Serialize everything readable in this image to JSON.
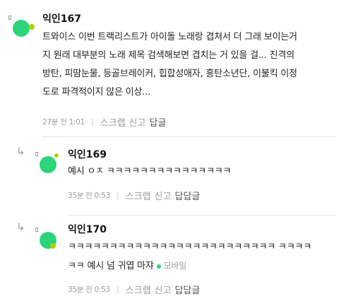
{
  "comments": [
    {
      "author": "익인167",
      "lines": [
        "트와이스 이번 트랙리스트가 아이돌 노래랑 겹쳐서 더 그래 보이는거",
        "지 원래 대부분의 노래 제목 검색해보면 겹치는 거 있을 걸... 진격의",
        "방탄, 피땀눈물, 등골브레이커, 힙합성애자, 흥탄소년단, 이불킥 이정",
        "도로 파격적이지 않은 이상..."
      ],
      "time": "27분 전 1:01",
      "scrap_label": "스크랩",
      "report_label": "신고",
      "reply_label": "답글"
    },
    {
      "author": "익인169",
      "lines": [
        "예시 ㅇㅈ ㅋㅋㅋㅋㅋㅋㅋㅋㅋㅋㅋㅋㅋㅋㅋ"
      ],
      "time": "35분 전 0:53",
      "scrap_label": "스크랩",
      "report_label": "신고",
      "reply_label": "답답글"
    },
    {
      "author": "익인170",
      "lines": [
        "ㅋㅋㅋㅋㅋㅋㅋㅋㅋㅋㅋㅋㅋㅋㅋㅋㅋㅋㅋㅋㅋㅋㅋㅋㅋ ㅋㅋㅋㅋ",
        "ㅋㅋ 예시 넘 귀엽 마쟈"
      ],
      "device": "모바일",
      "time": "35분 전 0:53",
      "scrap_label": "스크랩",
      "report_label": "신고",
      "reply_label": "답답글"
    }
  ],
  "icons": {
    "reply_indent": "reply-arrow-icon",
    "avatar": "anonymous-avatar-icon",
    "mobile": "mobile-dot-icon"
  },
  "colors": {
    "avatar_green": "#2ed47a",
    "avatar_lime": "#a8d400",
    "meta_gray": "#9b9b9b"
  }
}
